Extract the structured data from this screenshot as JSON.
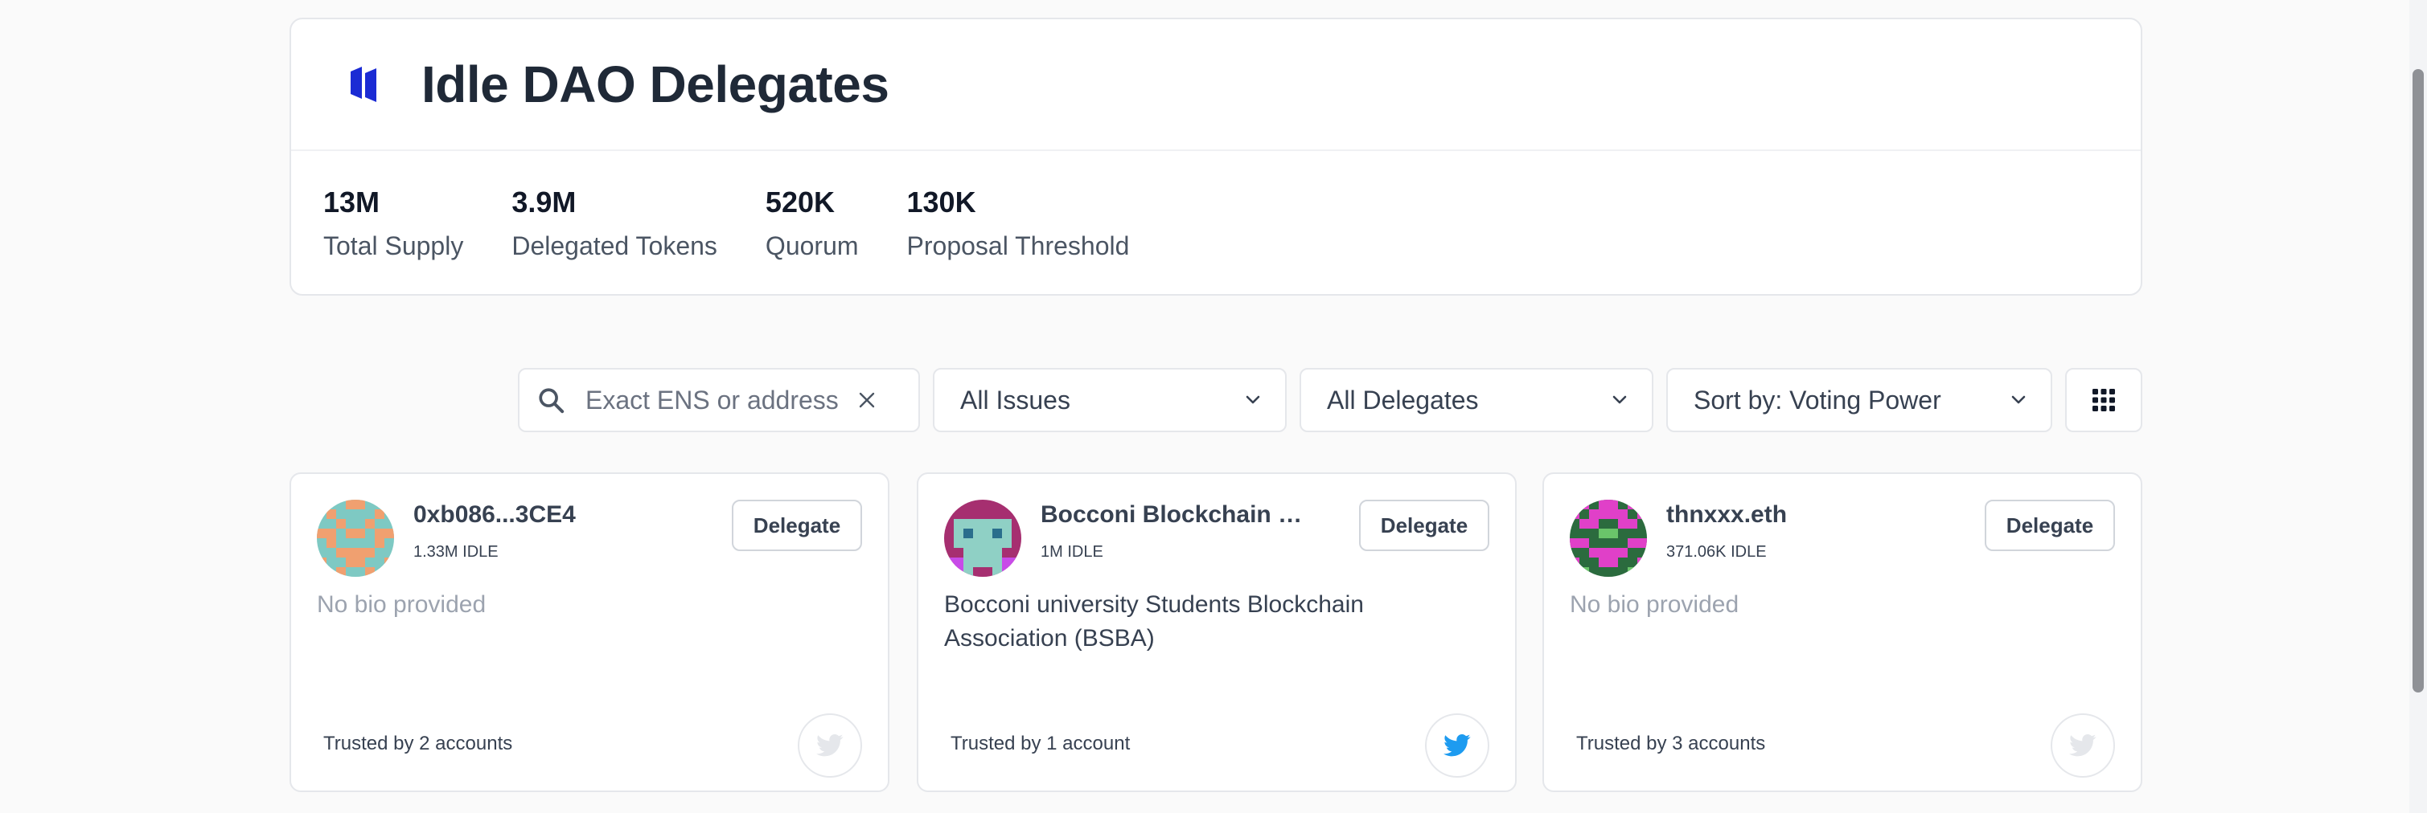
{
  "header": {
    "title": "Idle DAO Delegates",
    "logo_icon": "idle-logo-icon",
    "accent_color": "#1b2bd4"
  },
  "stats": [
    {
      "value": "13M",
      "label": "Total Supply"
    },
    {
      "value": "3.9M",
      "label": "Delegated Tokens"
    },
    {
      "value": "520K",
      "label": "Quorum"
    },
    {
      "value": "130K",
      "label": "Proposal Threshold"
    }
  ],
  "filters": {
    "search_placeholder": "Exact ENS or address",
    "search_value": "",
    "issues": "All Issues",
    "delegates": "All Delegates",
    "sort": "Sort by: Voting Power"
  },
  "delegates": [
    {
      "name": "0xb086...3CE4",
      "voting_power": "1.33M IDLE",
      "button": "Delegate",
      "bio": "No bio provided",
      "trusted": "Trusted by 2 accounts",
      "twitter_active": false
    },
    {
      "name": "Bocconi Blockchain C...",
      "voting_power": "1M IDLE",
      "button": "Delegate",
      "bio": "Bocconi university Students Blockchain Association (BSBA)",
      "trusted": "Trusted by 1 account",
      "twitter_active": true
    },
    {
      "name": "thnxxx.eth",
      "voting_power": "371.06K IDLE",
      "button": "Delegate",
      "bio": "No bio provided",
      "trusted": "Trusted by 3 accounts",
      "twitter_active": false
    }
  ],
  "colors": {
    "twitter_active": "#1d9bf0",
    "twitter_inactive": "#e5e7eb"
  }
}
